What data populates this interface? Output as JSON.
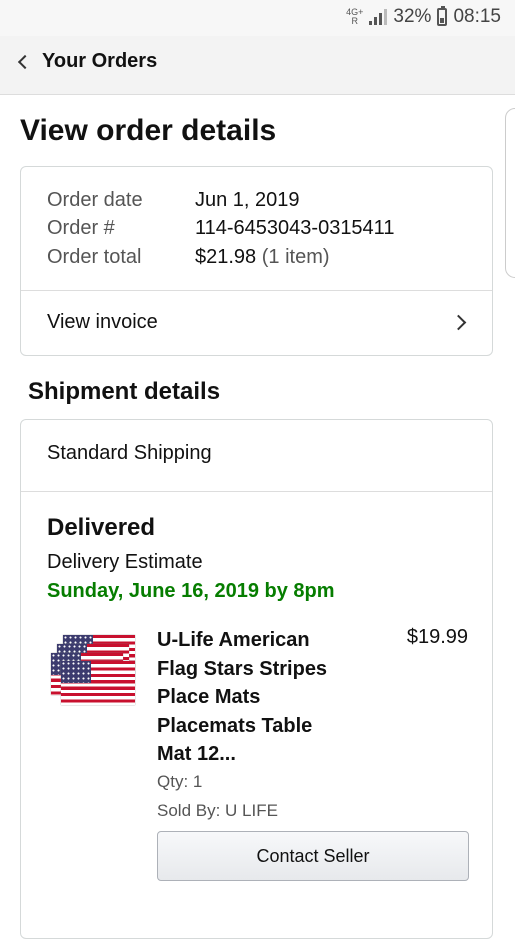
{
  "status_bar": {
    "network": "4G+",
    "roaming": "R",
    "battery": "32%",
    "time": "08:15"
  },
  "header": {
    "back_label": "Your Orders"
  },
  "page": {
    "title": "View order details"
  },
  "order": {
    "date_label": "Order date",
    "date_value": "Jun 1, 2019",
    "number_label": "Order #",
    "number_value": "114-6453043-0315411",
    "total_label": "Order total",
    "total_value": "$21.98",
    "total_items": "(1 item)",
    "invoice_label": "View invoice"
  },
  "shipment": {
    "section_title": "Shipment details",
    "method": "Standard Shipping",
    "status": "Delivered",
    "estimate_label": "Delivery Estimate",
    "estimate_date": "Sunday, June 16, 2019 by 8pm",
    "item": {
      "title_lines": [
        "U-Life American",
        "Flag Stars Stripes",
        "Place Mats",
        "Placemats Table",
        "Mat 12..."
      ],
      "price": "$19.99",
      "qty": "Qty: 1",
      "sold_by": "Sold By: U LIFE"
    },
    "contact_button": "Contact Seller"
  },
  "colors": {
    "delivery_green": "#067d00",
    "flag_red": "#c8102e",
    "flag_blue": "#3c3b6e"
  }
}
